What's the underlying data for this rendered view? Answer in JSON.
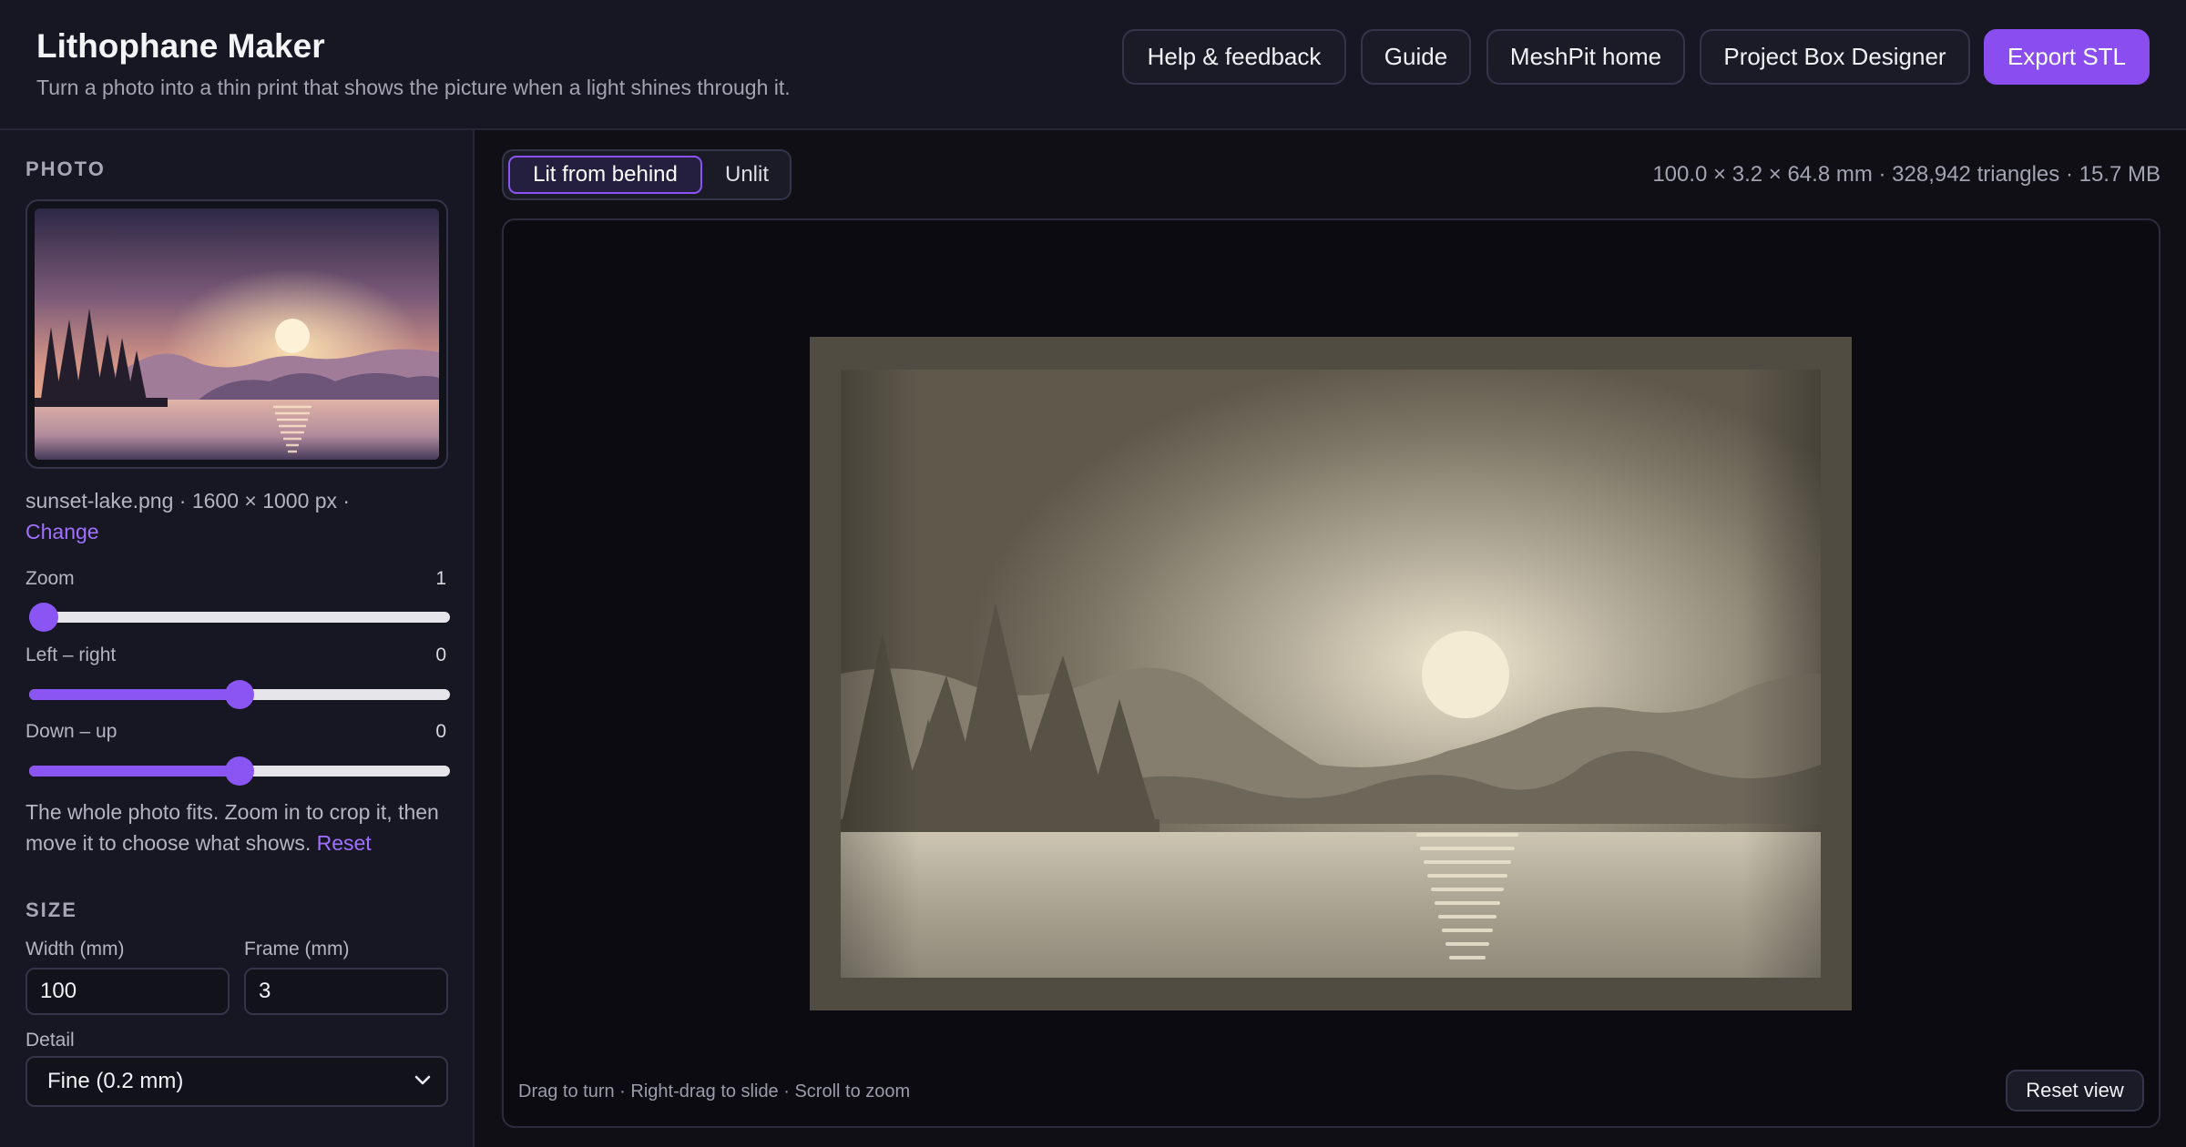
{
  "header": {
    "title": "Lithophane Maker",
    "subtitle": "Turn a photo into a thin print that shows the picture when a light shines through it.",
    "nav": {
      "help": "Help & feedback",
      "guide": "Guide",
      "home": "MeshPit home",
      "project_box": "Project Box Designer",
      "export": "Export STL"
    }
  },
  "sidebar": {
    "photo": {
      "heading": "PHOTO",
      "file_name": "sunset-lake.png · 1600 × 1000 px ·",
      "change_label": "Change"
    },
    "zoom": {
      "label": "Zoom",
      "value": "1",
      "fraction": 0
    },
    "left_right": {
      "label": "Left – right",
      "value": "0",
      "fraction": 0.5
    },
    "down_up": {
      "label": "Down – up",
      "value": "0",
      "fraction": 0.5
    },
    "hint": "The whole photo fits. Zoom in to crop it, then move it to choose what shows.",
    "reset_label": "Reset",
    "size": {
      "heading": "SIZE",
      "width_label": "Width (mm)",
      "width_value": "100",
      "frame_label": "Frame (mm)",
      "frame_value": "3",
      "detail_label": "Detail",
      "detail_value": "Fine (0.2 mm)"
    }
  },
  "main": {
    "lighting_modes": [
      "Lit from behind",
      "Unlit"
    ],
    "active_mode": "Lit from behind",
    "stats": "100.0 × 3.2 × 64.8 mm · 328,942 triangles · 15.7 MB",
    "viewport_hint": "Drag to turn · Right-drag to slide · Scroll to zoom",
    "reset_view_label": "Reset view"
  },
  "colors": {
    "accent": "#8a4df0",
    "background": "#0f0f15",
    "panel": "#171723"
  }
}
